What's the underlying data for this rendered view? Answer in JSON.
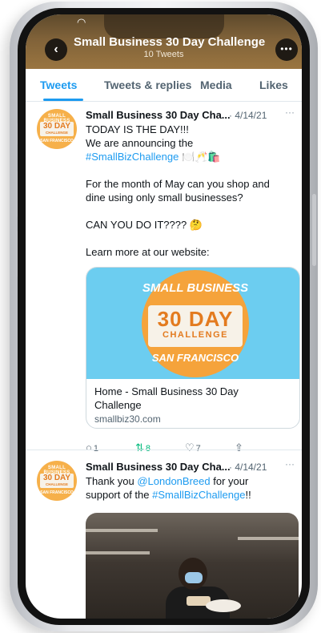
{
  "header": {
    "title": "Small Business 30 Day Challenge",
    "subtitle": "10 Tweets",
    "back_icon": "chevron-left-icon",
    "more_icon": "more-horizontal-icon",
    "more_glyph": "•••",
    "back_glyph": "‹",
    "wifi_glyph": "◠"
  },
  "tabs": [
    {
      "label": "Tweets",
      "active": true
    },
    {
      "label": "Tweets & replies",
      "active": false
    },
    {
      "label": "Media",
      "active": false
    },
    {
      "label": "Likes",
      "active": false
    }
  ],
  "avatar": {
    "top": "SMALL BUSINESS",
    "number": "30 DAY",
    "challenge": "CHALLENGE",
    "bottom": "SAN FRANCISCO"
  },
  "tweets": [
    {
      "name": "Small Business 30 Day Cha...",
      "date": "· 4/14/21",
      "more": "···",
      "lines": {
        "l1": "TODAY IS THE DAY!!!",
        "l2": "We are announcing the",
        "hashtag": "#SmallBizChallenge",
        "emojis": "🍽️🥂🛍️",
        "l4": "For the month of May can you shop and",
        "l5": "dine using only small businesses?",
        "l6": "CAN YOU DO IT???? 🤔",
        "l7": "Learn more at our website:"
      },
      "card": {
        "title": "Home - Small Business 30 Day Challenge",
        "url": "smallbiz30.com",
        "badge_top": "SMALL BUSINESS",
        "badge_num": "30 DAY",
        "badge_chal": "CHALLENGE",
        "badge_bottom": "SAN FRANCISCO"
      },
      "actions": {
        "reply": "1",
        "retweet": "8",
        "like": "7",
        "reply_glyph": "○",
        "retweet_glyph": "⇅",
        "like_glyph": "♡",
        "share_glyph": "⇧"
      }
    },
    {
      "name": "Small Business 30 Day Cha...",
      "date": "· 4/14/21",
      "more": "···",
      "lines": {
        "l1a": "Thank you ",
        "mention": "@LondonBreed",
        "l1b": " for your",
        "l2a": "support of the ",
        "hashtag": "#SmallBizChallenge",
        "l2b": "!!"
      }
    }
  ]
}
